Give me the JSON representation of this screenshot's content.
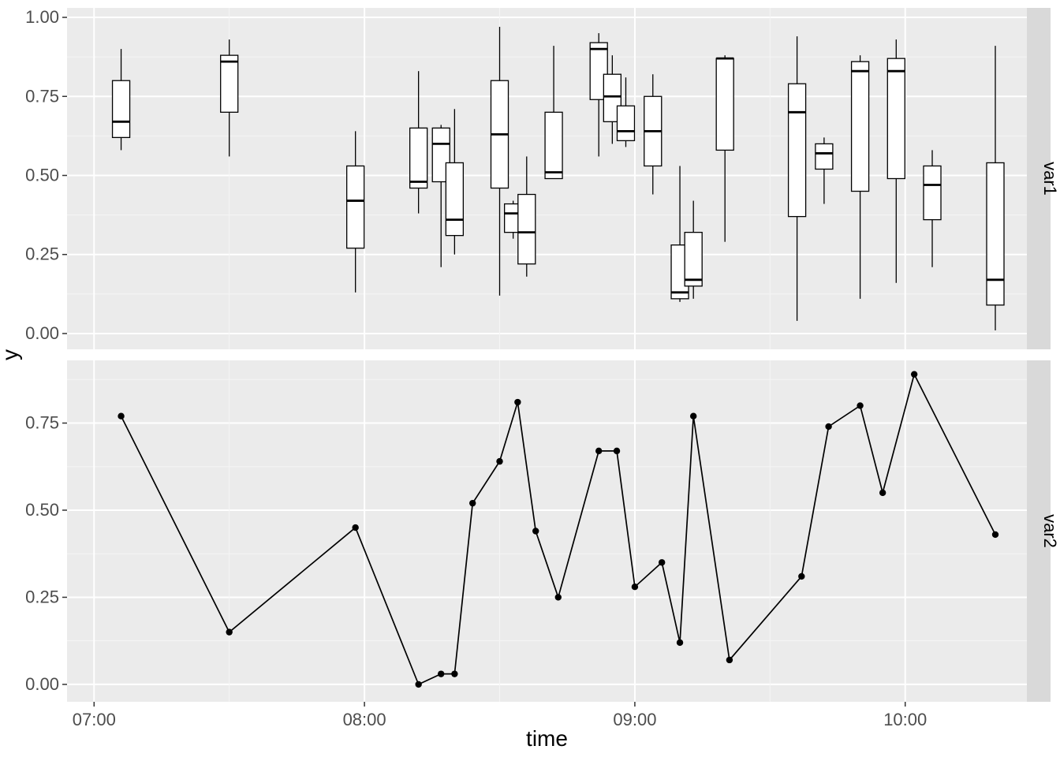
{
  "chart_data": [
    {
      "type": "boxplot",
      "facet_label": "var1",
      "xlabel": "time",
      "ylabel": "y",
      "xlim": [
        "07:00",
        "10:30"
      ],
      "ylim": [
        0.0,
        1.0
      ],
      "x_ticks": [
        "07:00",
        "08:00",
        "09:00",
        "10:00"
      ],
      "y_ticks": [
        0.0,
        0.25,
        0.5,
        0.75,
        1.0
      ],
      "boxes": [
        {
          "time": "07:06",
          "low": 0.58,
          "q1": 0.62,
          "median": 0.67,
          "q3": 0.8,
          "high": 0.9
        },
        {
          "time": "07:30",
          "low": 0.56,
          "q1": 0.7,
          "median": 0.86,
          "q3": 0.88,
          "high": 0.93
        },
        {
          "time": "07:58",
          "low": 0.13,
          "q1": 0.27,
          "median": 0.42,
          "q3": 0.53,
          "high": 0.64
        },
        {
          "time": "08:12",
          "low": 0.38,
          "q1": 0.46,
          "median": 0.48,
          "q3": 0.65,
          "high": 0.83
        },
        {
          "time": "08:17",
          "low": 0.21,
          "q1": 0.48,
          "median": 0.6,
          "q3": 0.65,
          "high": 0.66
        },
        {
          "time": "08:20",
          "low": 0.25,
          "q1": 0.31,
          "median": 0.36,
          "q3": 0.54,
          "high": 0.71
        },
        {
          "time": "08:30",
          "low": 0.12,
          "q1": 0.46,
          "median": 0.63,
          "q3": 0.8,
          "high": 0.97
        },
        {
          "time": "08:33",
          "low": 0.3,
          "q1": 0.32,
          "median": 0.38,
          "q3": 0.41,
          "high": 0.42
        },
        {
          "time": "08:36",
          "low": 0.18,
          "q1": 0.22,
          "median": 0.32,
          "q3": 0.44,
          "high": 0.56
        },
        {
          "time": "08:42",
          "low": 0.49,
          "q1": 0.49,
          "median": 0.51,
          "q3": 0.7,
          "high": 0.91
        },
        {
          "time": "08:52",
          "low": 0.56,
          "q1": 0.74,
          "median": 0.9,
          "q3": 0.92,
          "high": 0.95
        },
        {
          "time": "08:55",
          "low": 0.6,
          "q1": 0.67,
          "median": 0.75,
          "q3": 0.82,
          "high": 0.88
        },
        {
          "time": "08:58",
          "low": 0.59,
          "q1": 0.61,
          "median": 0.64,
          "q3": 0.72,
          "high": 0.81
        },
        {
          "time": "09:04",
          "low": 0.44,
          "q1": 0.53,
          "median": 0.64,
          "q3": 0.75,
          "high": 0.82
        },
        {
          "time": "09:10",
          "low": 0.1,
          "q1": 0.11,
          "median": 0.13,
          "q3": 0.28,
          "high": 0.53
        },
        {
          "time": "09:13",
          "low": 0.11,
          "q1": 0.15,
          "median": 0.17,
          "q3": 0.32,
          "high": 0.42
        },
        {
          "time": "09:20",
          "low": 0.29,
          "q1": 0.58,
          "median": 0.87,
          "q3": 0.87,
          "high": 0.88
        },
        {
          "time": "09:36",
          "low": 0.04,
          "q1": 0.37,
          "median": 0.7,
          "q3": 0.79,
          "high": 0.94
        },
        {
          "time": "09:42",
          "low": 0.41,
          "q1": 0.52,
          "median": 0.57,
          "q3": 0.6,
          "high": 0.62
        },
        {
          "time": "09:50",
          "low": 0.11,
          "q1": 0.45,
          "median": 0.83,
          "q3": 0.86,
          "high": 0.88
        },
        {
          "time": "09:58",
          "low": 0.16,
          "q1": 0.49,
          "median": 0.83,
          "q3": 0.87,
          "high": 0.93
        },
        {
          "time": "10:06",
          "low": 0.21,
          "q1": 0.36,
          "median": 0.47,
          "q3": 0.53,
          "high": 0.58
        },
        {
          "time": "10:20",
          "low": 0.01,
          "q1": 0.09,
          "median": 0.17,
          "q3": 0.54,
          "high": 0.91
        }
      ]
    },
    {
      "type": "line",
      "facet_label": "var2",
      "xlabel": "time",
      "ylabel": "y",
      "xlim": [
        "07:00",
        "10:30"
      ],
      "ylim": [
        0.0,
        1.0
      ],
      "x_ticks": [
        "07:00",
        "08:00",
        "09:00",
        "10:00"
      ],
      "y_ticks": [
        0.0,
        0.25,
        0.5,
        0.75
      ],
      "series": [
        {
          "name": "var2",
          "points": [
            {
              "time": "07:06",
              "y": 0.77
            },
            {
              "time": "07:30",
              "y": 0.15
            },
            {
              "time": "07:58",
              "y": 0.45
            },
            {
              "time": "08:12",
              "y": 0.0
            },
            {
              "time": "08:17",
              "y": 0.03
            },
            {
              "time": "08:20",
              "y": 0.03
            },
            {
              "time": "08:24",
              "y": 0.52
            },
            {
              "time": "08:30",
              "y": 0.64
            },
            {
              "time": "08:34",
              "y": 0.81
            },
            {
              "time": "08:38",
              "y": 0.44
            },
            {
              "time": "08:43",
              "y": 0.25
            },
            {
              "time": "08:52",
              "y": 0.67
            },
            {
              "time": "08:56",
              "y": 0.67
            },
            {
              "time": "09:00",
              "y": 0.28
            },
            {
              "time": "09:06",
              "y": 0.35
            },
            {
              "time": "09:10",
              "y": 0.12
            },
            {
              "time": "09:13",
              "y": 0.77
            },
            {
              "time": "09:21",
              "y": 0.07
            },
            {
              "time": "09:37",
              "y": 0.31
            },
            {
              "time": "09:43",
              "y": 0.74
            },
            {
              "time": "09:50",
              "y": 0.8
            },
            {
              "time": "09:55",
              "y": 0.55
            },
            {
              "time": "10:02",
              "y": 0.89
            },
            {
              "time": "10:20",
              "y": 0.43
            }
          ]
        }
      ]
    }
  ],
  "axis_labels": {
    "x": "time",
    "y": "y"
  }
}
